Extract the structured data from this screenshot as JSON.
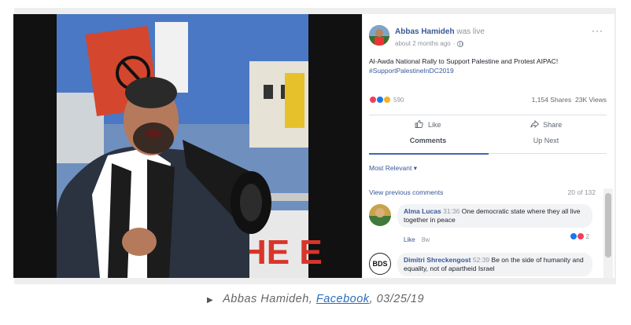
{
  "post": {
    "author": "Abbas Hamideh",
    "status": "was live",
    "time": "about 2 months ago",
    "description": "Al-Awda National Rally to Support Palestine and Protest AIPAC!",
    "hashtag": "#SupportPalestineInDC2019",
    "more": "···"
  },
  "stats": {
    "reaction_count": "590",
    "shares": "1,154 Shares",
    "views": "23K Views"
  },
  "actions": {
    "like": "Like",
    "share": "Share",
    "comments": "Comments",
    "up_next": "Up Next"
  },
  "comments_header": {
    "sort": "Most Relevant ▾",
    "view_previous": "View previous comments",
    "count": "20 of 132"
  },
  "comments": [
    {
      "author": "Alma Lucas",
      "time": "31:36",
      "text": "One democratic state where they all live together in peace",
      "like": "Like",
      "age": "8w",
      "reactions": "2"
    },
    {
      "author": "Dimitri Shreckengost",
      "time": "52:39",
      "text": "Be on the side of humanity and equality, not of apartheid Israel",
      "avatar_text": "BDS"
    }
  ],
  "caption": {
    "prefix": "Abbas Hamideh, ",
    "link": "Facebook",
    "suffix": ", 03/25/19"
  },
  "colors": {
    "link_blue": "#385898",
    "accent": "#4267b2",
    "love_red": "#f33e58",
    "like_blue": "#1877f2",
    "haha_yellow": "#f7b125"
  }
}
